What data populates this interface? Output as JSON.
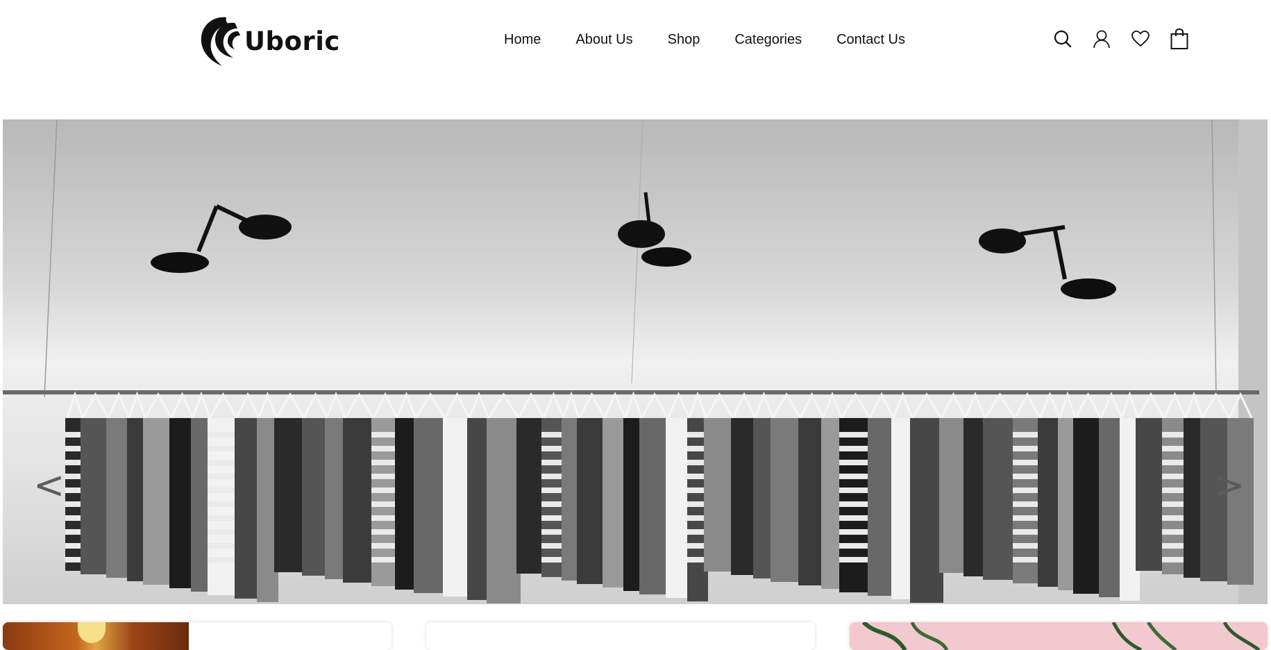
{
  "brand": {
    "name": "Uboric",
    "logo_icon": "swirl-logo-icon"
  },
  "nav": {
    "items": [
      {
        "label": "Home"
      },
      {
        "label": "About Us"
      },
      {
        "label": "Shop"
      },
      {
        "label": "Categories"
      },
      {
        "label": "Contact Us"
      }
    ]
  },
  "header_icons": [
    "search-icon",
    "user-icon",
    "heart-icon",
    "bag-icon"
  ],
  "hero": {
    "prev_label": "<",
    "next_label": ">"
  }
}
